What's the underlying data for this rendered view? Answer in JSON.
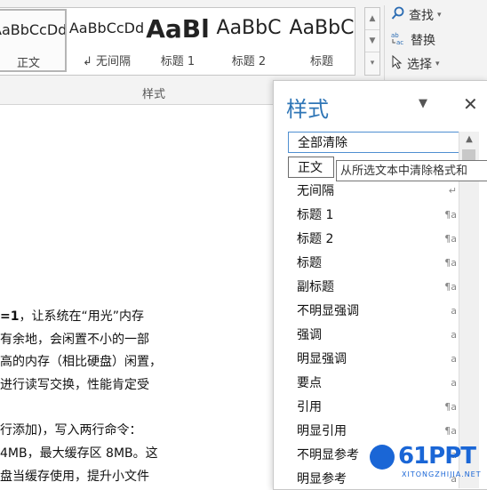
{
  "gallery": {
    "items": [
      {
        "sample": "AaBbCcDd",
        "label": "正文"
      },
      {
        "sample": "AaBbCcDd",
        "label": "↲ 无间隔"
      },
      {
        "sample": "AaBl",
        "label": "标题 1"
      },
      {
        "sample": "AaBbC",
        "label": "标题 2"
      },
      {
        "sample": "AaBbC",
        "label": "标题"
      }
    ],
    "group_label": "样式"
  },
  "editing": {
    "find": "查找",
    "replace": "替换",
    "select": "选择"
  },
  "document": {
    "lines": [
      {
        "bold": "=1",
        "rest": "，让系统在“用光”内存"
      },
      {
        "bold": "",
        "rest": "有余地，会闲置不小的一部"
      },
      {
        "bold": "",
        "rest": "高的内存（相比硬盘）闲置，"
      },
      {
        "bold": "",
        "rest": "进行读写交换，性能肯定受"
      },
      {
        "bold": "",
        "rest": "行添加)，写入两行命令："
      },
      {
        "bold": "",
        "rest": "4MB，最大缓存区 8MB。这"
      },
      {
        "bold": "",
        "rest": "盘当缓存使用，提升小文件"
      }
    ]
  },
  "styles_pane": {
    "title": "样式",
    "items": [
      {
        "name": "全部清除",
        "marker": ""
      },
      {
        "name": "正文",
        "marker": ""
      },
      {
        "name": "无间隔",
        "marker": "↵"
      },
      {
        "name": "标题 1",
        "marker": "¶a"
      },
      {
        "name": "标题 2",
        "marker": "¶a"
      },
      {
        "name": "标题",
        "marker": "¶a"
      },
      {
        "name": "副标题",
        "marker": "¶a"
      },
      {
        "name": "不明显强调",
        "marker": "a"
      },
      {
        "name": "强调",
        "marker": "a"
      },
      {
        "name": "明显强调",
        "marker": "a"
      },
      {
        "name": "要点",
        "marker": "a"
      },
      {
        "name": "引用",
        "marker": "¶a"
      },
      {
        "name": "明显引用",
        "marker": "¶a"
      },
      {
        "name": "不明显参考",
        "marker": "a"
      },
      {
        "name": "明显参考",
        "marker": "a"
      }
    ],
    "tooltip": "从所选文本中清除格式和"
  },
  "watermark": {
    "brand": "61PPT",
    "url": "XITONGZHIJIA.NET"
  },
  "colors": {
    "accent": "#2e75b6",
    "watermark": "#1a66d6"
  }
}
